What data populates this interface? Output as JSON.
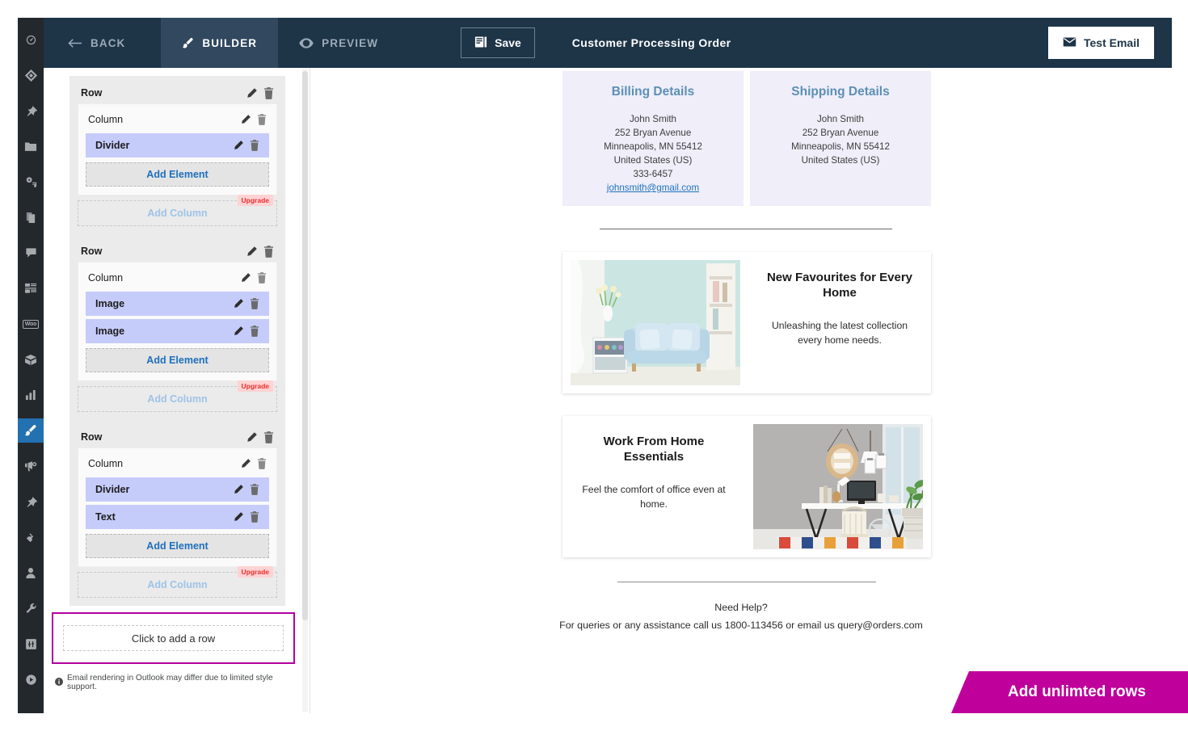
{
  "header": {
    "back_label": "BACK",
    "builder_label": "BUILDER",
    "preview_label": "PREVIEW",
    "save_label": "Save",
    "document_title": "Customer Processing Order",
    "test_email_label": "Test Email",
    "bg_color": "#1E3447",
    "active_tab_color": "#31485F"
  },
  "sidebar": {
    "items": [
      {
        "name": "dashboard-icon"
      },
      {
        "name": "diamond-icon"
      },
      {
        "name": "pin-icon"
      },
      {
        "name": "folder-icon"
      },
      {
        "name": "media-icon"
      },
      {
        "name": "pages-icon"
      },
      {
        "name": "comments-icon"
      },
      {
        "name": "layout-icon"
      },
      {
        "name": "woo-icon",
        "label": "Woo"
      },
      {
        "name": "products-icon"
      },
      {
        "name": "analytics-icon"
      },
      {
        "name": "brush-icon",
        "active": true
      },
      {
        "name": "megaphone-icon"
      },
      {
        "name": "pin2-icon"
      },
      {
        "name": "plugins-icon"
      },
      {
        "name": "users-icon"
      },
      {
        "name": "tools-icon"
      },
      {
        "name": "settings-icon"
      },
      {
        "name": "play-icon"
      }
    ],
    "active_color": "#2271B1",
    "bg_color": "#23282D"
  },
  "builder": {
    "rows": [
      {
        "row_label": "Row",
        "column_label": "Column",
        "elements": [
          {
            "label": "Divider"
          }
        ],
        "add_element_label": "Add Element",
        "add_column_label": "Add Column",
        "upgrade_label": "Upgrade"
      },
      {
        "row_label": "Row",
        "column_label": "Column",
        "elements": [
          {
            "label": "Image"
          },
          {
            "label": "Image"
          }
        ],
        "add_element_label": "Add Element",
        "add_column_label": "Add Column",
        "upgrade_label": "Upgrade"
      },
      {
        "row_label": "Row",
        "column_label": "Column",
        "elements": [
          {
            "label": "Divider"
          },
          {
            "label": "Text"
          }
        ],
        "add_element_label": "Add Element",
        "add_column_label": "Add Column",
        "upgrade_label": "Upgrade"
      }
    ],
    "add_row_label": "Click to add a row",
    "add_row_highlight_color": "#B4009E",
    "outlook_note": "Email rendering in Outlook may differ due to limited style support.",
    "element_color": "#C6CCFA",
    "upgrade_badge_color": "#E8302F"
  },
  "email": {
    "billing": {
      "title": "Billing Details",
      "lines": [
        "John Smith",
        "252 Bryan Avenue",
        "Minneapolis, MN 55412",
        "United States (US)",
        "333-6457"
      ],
      "email": "johnsmith@gmail.com"
    },
    "shipping": {
      "title": "Shipping Details",
      "lines": [
        "John Smith",
        "252 Bryan Avenue",
        "Minneapolis, MN 55412",
        "United States (US)"
      ]
    },
    "products": [
      {
        "title": "New Favourites for Every Home",
        "description": "Unleashing the latest collection every home needs.",
        "image_alt": "light-blue-sofa-living-room"
      },
      {
        "title": "Work From Home Essentials",
        "description": "Feel the comfort of office even at home.",
        "image_alt": "home-office-desk-setup"
      }
    ],
    "footer": {
      "heading": "Need Help?",
      "contact": "For queries or any assistance call us 1800-113456 or email us query@orders.com"
    },
    "heading_color": "#5C8FB5",
    "card_bg_color": "#EFEEF9"
  },
  "promo": {
    "label": "Add unlimted rows",
    "color": "#BF009B"
  }
}
